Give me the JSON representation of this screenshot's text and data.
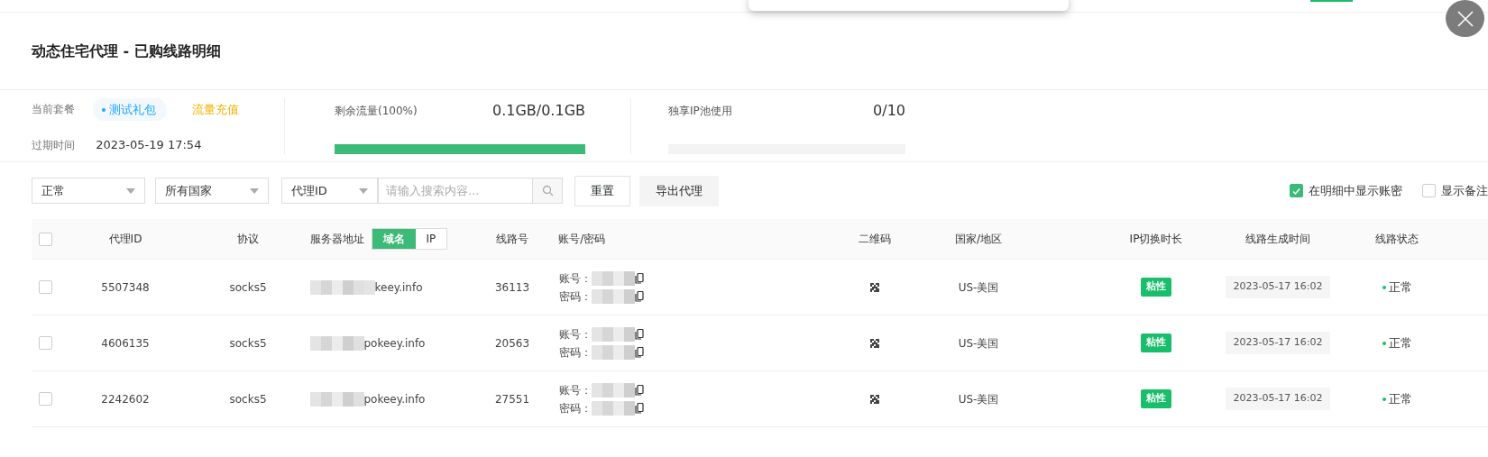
{
  "modal": {
    "title": "动态住宅代理 - 已购线路明细"
  },
  "plan": {
    "label": "当前套餐",
    "name": "测试礼包",
    "action": "流量充值",
    "expiry_label": "过期时间",
    "expiry": "2023-05-19 17:54"
  },
  "meters": [
    {
      "label": "剩余流量(100%)",
      "value": "0.1GB/0.1GB",
      "level": 1
    },
    {
      "label": "独享IP池使用",
      "value": "0/10",
      "level": 0
    }
  ],
  "filters": {
    "selects": [
      "正常",
      "所有国家",
      "代理ID"
    ],
    "search": {
      "placeholder": "请输入搜索内容..."
    },
    "buttons": [
      {
        "label": "重置",
        "kind": "outline"
      },
      {
        "label": "导出代理",
        "kind": "filled"
      }
    ],
    "options": [
      {
        "label": "在明细中显示账密",
        "checked": true
      },
      {
        "label": "显示备注",
        "checked": false
      }
    ]
  },
  "table": {
    "header_checked": false,
    "columns": [
      "代理ID",
      "协议",
      "服务器地址",
      "线路号",
      "账号/密码",
      "二维码",
      "国家/地区",
      "IP切换时长",
      "线路生成时间",
      "线路状态"
    ],
    "server_toggle": [
      {
        "label": "域名",
        "selected": true
      },
      {
        "label": "IP",
        "selected": false
      }
    ],
    "rows": [
      {
        "checked": false,
        "id": "5507348",
        "protocol": "socks5",
        "server": "keey.info",
        "line": "36113",
        "account_label": "账号：",
        "password_label": "密码：",
        "country": "US-美国",
        "ip_mode": "粘性",
        "created": "2023-05-17 16:02",
        "status": "正常"
      },
      {
        "checked": false,
        "id": "4606135",
        "protocol": "socks5",
        "server": "pokeey.info",
        "line": "20563",
        "account_label": "账号：",
        "password_label": "密码：",
        "country": "US-美国",
        "ip_mode": "粘性",
        "created": "2023-05-17 16:02",
        "status": "正常"
      },
      {
        "checked": false,
        "id": "2242602",
        "protocol": "socks5",
        "server": "pokeey.info",
        "line": "27551",
        "account_label": "账号：",
        "password_label": "密码：",
        "country": "US-美国",
        "ip_mode": "粘性",
        "created": "2023-05-17 16:02",
        "status": "正常"
      }
    ]
  }
}
